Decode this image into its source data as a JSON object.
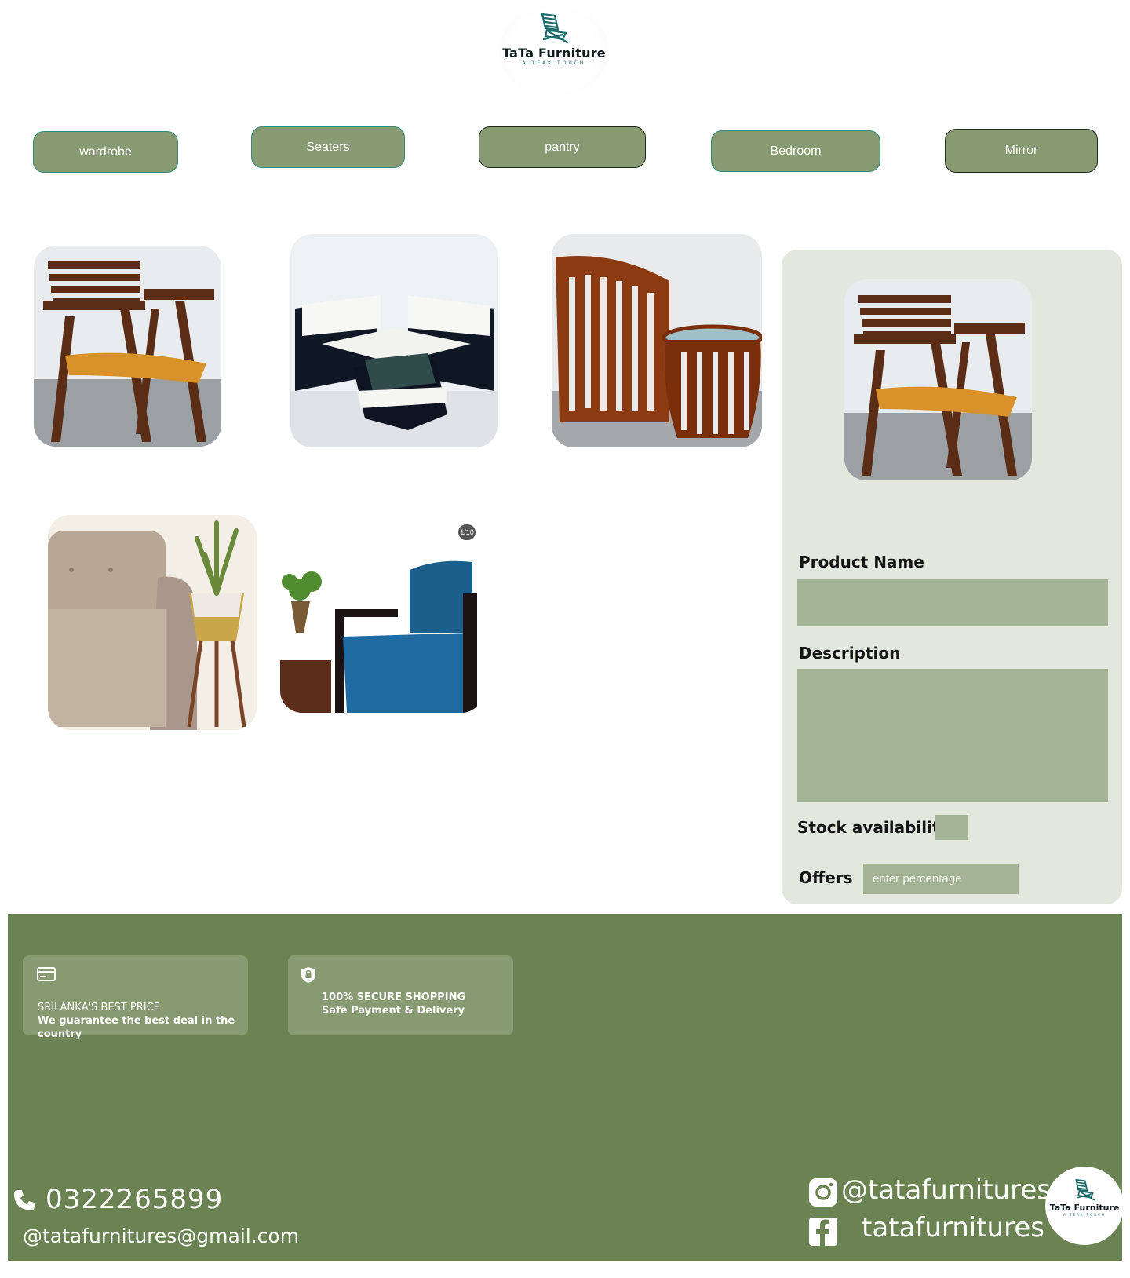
{
  "brand": {
    "name": "TaTa Furniture",
    "tagline": "A TEAK TOUCH"
  },
  "categories": [
    "wardrobe",
    "Seaters",
    "pantry",
    "Bedroom",
    "Mirror"
  ],
  "gallery": {
    "items": [
      {
        "name": "teak-armchair"
      },
      {
        "name": "corner-sofa-set"
      },
      {
        "name": "teak-chair-and-table"
      },
      {
        "name": "beige-sofa"
      },
      {
        "name": "blue-accent-chair",
        "counter": "1/10"
      }
    ]
  },
  "form": {
    "product_name_label": "Product Name",
    "description_label": "Description",
    "stock_label": "Stock availability",
    "offers_label": "Offers",
    "offers_placeholder": "enter percentage"
  },
  "footer": {
    "badges": [
      {
        "icon": "card-icon",
        "title": "SRILANKA'S BEST PRICE",
        "text": "We guarantee the best deal in the country"
      },
      {
        "icon": "shield-lock-icon",
        "title": "100% SECURE SHOPPING",
        "text": "Safe Payment & Delivery"
      }
    ],
    "phone": "0322265899",
    "email": "@tatafurnitures@gmail.com",
    "instagram": "@tatafurnitures",
    "facebook": "tatafurnitures"
  },
  "colors": {
    "button_green": "#879a72",
    "panel_bg": "#e3e8de",
    "field_green": "#a5b495",
    "footer_green": "#6b8352"
  }
}
